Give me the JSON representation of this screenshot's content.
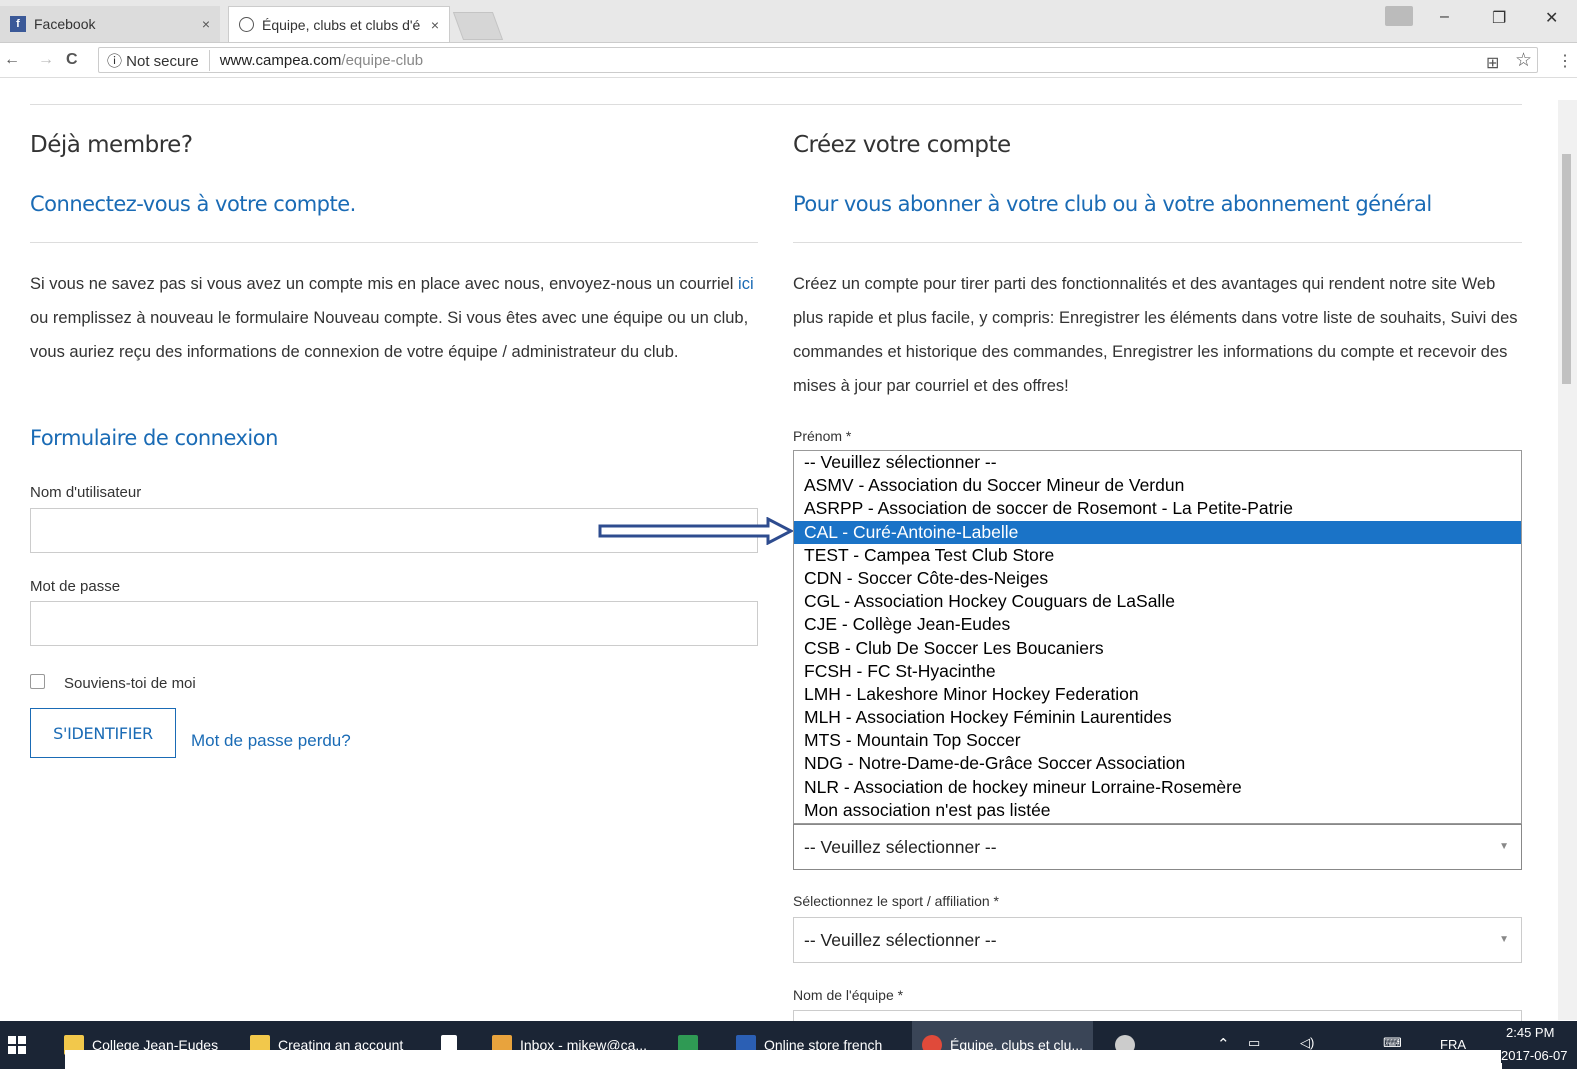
{
  "browser": {
    "tabs": [
      {
        "label": "Facebook",
        "icon": "facebook-icon",
        "close": "×"
      },
      {
        "label": "Équipe, clubs et clubs d'é",
        "icon": "site-icon",
        "close": "×"
      }
    ],
    "window_controls": {
      "minimize": "–",
      "restore": "❐",
      "close": "✕"
    },
    "nav": {
      "back": "←",
      "forward": "→",
      "reload": "C"
    },
    "address": {
      "security": "ⓘ Not secure",
      "host": "www.campea.com",
      "path": "/equipe-club"
    },
    "right_icons": {
      "translate": "⊞",
      "star": "☆",
      "menu": "⋮"
    }
  },
  "login": {
    "heading": "Déjà membre?",
    "subheading": "Connectez-vous à votre compte.",
    "para_before_link": "Si vous ne savez pas si vous avez un compte mis en place avec nous, envoyez-nous un courriel ",
    "para_link": "ici",
    "para_after_link": " ou remplissez à nouveau le formulaire Nouveau compte. Si vous êtes avec une équipe ou un club, vous auriez reçu des informations de connexion de votre équipe / administrateur du club.",
    "form_title": "Formulaire de connexion",
    "username_label": "Nom d'utilisateur",
    "username_value": "",
    "password_label": "Mot de passe",
    "password_value": "",
    "remember_label": "Souviens-toi de moi",
    "submit_label": "S'IDENTIFIER",
    "lost_password": "Mot de passe perdu?"
  },
  "register": {
    "heading": "Créez votre compte",
    "subheading": "Pour vous abonner à votre club ou à votre abonnement général",
    "para": "Créez un compte pour tirer parti des fonctionnalités et des avantages qui rendent notre site Web plus rapide et plus facile, y compris: Enregistrer les éléments dans votre liste de souhaits, Suivi des commandes et historique des commandes, Enregistrer les informations du compte et recevoir des mises à jour par courriel et des offres!",
    "first_name_label": "Prénom *",
    "options": [
      "-- Veuillez sélectionner --",
      "ASMV - Association du Soccer Mineur de Verdun",
      "ASRPP - Association de soccer de Rosemont - La Petite-Patrie",
      "CAL - Curé-Antoine-Labelle",
      "TEST - Campea Test Club Store",
      "CDN - Soccer Côte-des-Neiges",
      "CGL - Association Hockey Couguars de LaSalle",
      "CJE - Collège Jean-Eudes",
      "CSB - Club De Soccer Les Boucaniers",
      "FCSH - FC St-Hyacinthe",
      "LMH - Lakeshore Minor Hockey Federation",
      "MLH - Association Hockey Féminin Laurentides",
      "MTS - Mountain Top Soccer",
      "NDG - Notre-Dame-de-Grâce Soccer Association",
      "NLR - Association de hockey mineur Lorraine-Rosemère",
      "Mon association n'est pas listée"
    ],
    "highlighted_option": "CAL - Curé-Antoine-Labelle",
    "club_select_value": "-- Veuillez sélectionner --",
    "sport_label": "Sélectionnez le sport / affiliation *",
    "sport_select_value": "-- Veuillez sélectionner --",
    "team_label": "Nom de l'équipe *"
  },
  "taskbar": {
    "items": [
      {
        "label": "College Jean-Eudes",
        "icon": "folder-icon",
        "color": "#f2c84b"
      },
      {
        "label": "Creating an account",
        "icon": "folder-icon",
        "color": "#f2c84b"
      },
      {
        "label": "",
        "icon": "store-icon",
        "color": "#ffffff"
      },
      {
        "label": "Inbox - mikew@ca...",
        "icon": "outlook-icon",
        "color": "#e8a33d"
      },
      {
        "label": "",
        "icon": "excel-icon",
        "color": "#2f9a54"
      },
      {
        "label": "Online store french",
        "icon": "word-icon",
        "color": "#2b5fb4"
      },
      {
        "label": "Équipe, clubs et clu...",
        "icon": "chrome-icon",
        "color": "#e04a3a"
      },
      {
        "label": "",
        "icon": "paint-icon",
        "color": "#cccccc"
      }
    ],
    "language": "FRA",
    "time": "2:45 PM",
    "date": "2017-06-07"
  },
  "colors": {
    "link": "#1a6bb5",
    "selected": "#1a73c7",
    "arrow": "#2e4c8f",
    "taskbar": "#1b2535"
  }
}
